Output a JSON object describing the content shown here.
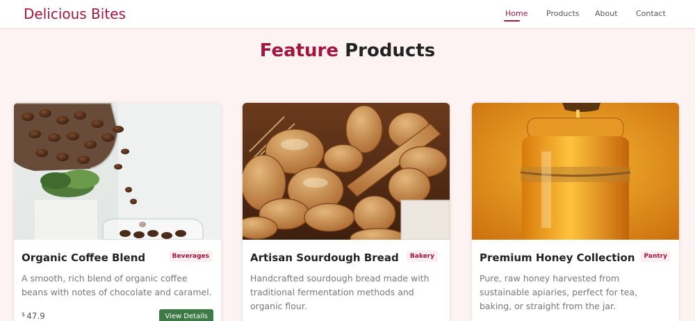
{
  "brand": "Delicious Bites",
  "nav": {
    "home": "Home",
    "products": "Products",
    "about": "About",
    "contact": "Contact"
  },
  "section": {
    "title_accent": "Feature",
    "title_rest": "Products"
  },
  "products": [
    {
      "title": "Organic Coffee Blend",
      "category": "Beverages",
      "description": "A smooth, rich blend of organic coffee beans with notes of chocolate and caramel.",
      "currency": "$",
      "price": "47.9",
      "button": "View Details"
    },
    {
      "title": "Artisan Sourdough Bread",
      "category": "Bakery",
      "description": "Handcrafted sourdough bread made with traditional fermentation methods and organic flour."
    },
    {
      "title": "Premium Honey Collection",
      "category": "Pantry",
      "description": "Pure, raw honey harvested from sustainable apiaries, perfect for tea, baking, or straight from the jar."
    }
  ],
  "colors": {
    "brand": "#a3153f",
    "page_bg": "#fdf3f2",
    "button": "#3d7a45"
  }
}
